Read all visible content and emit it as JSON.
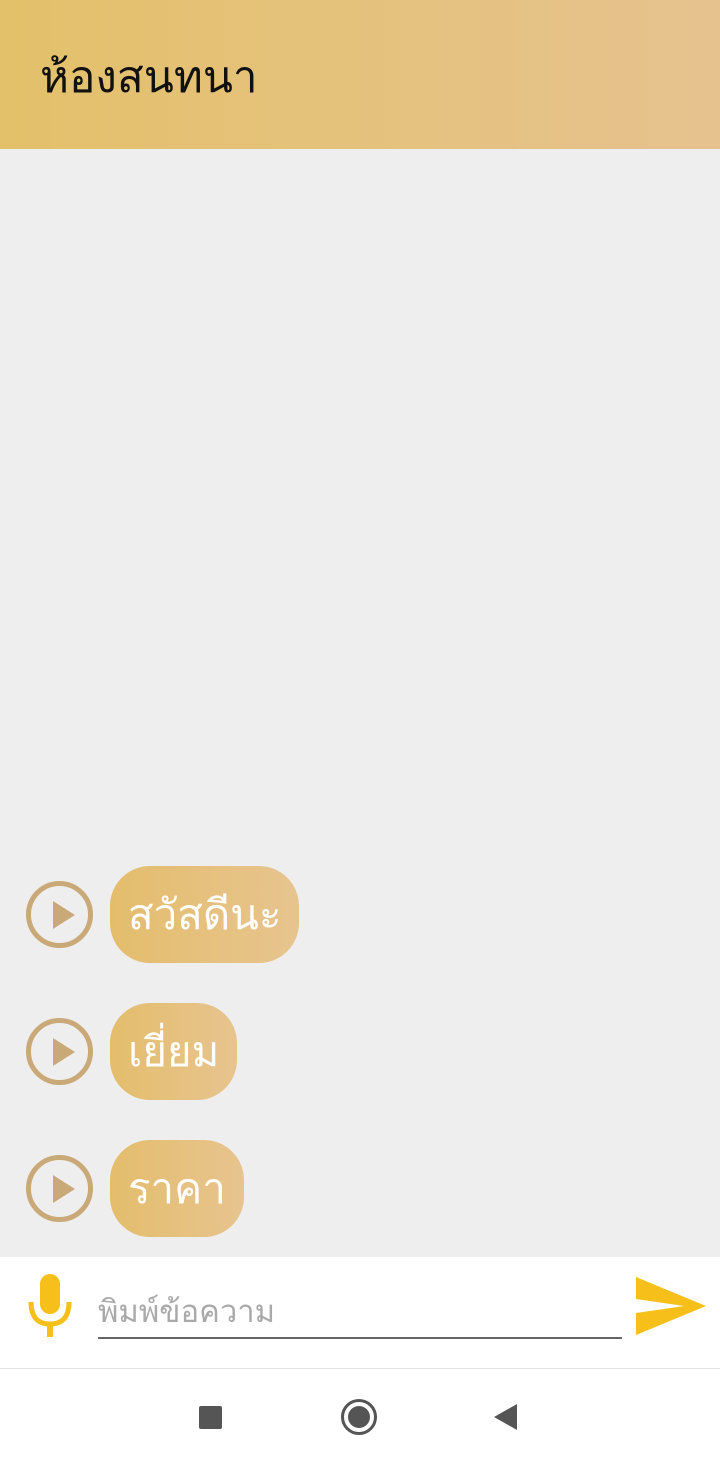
{
  "header": {
    "title": "ห้องสนทนา"
  },
  "messages": [
    {
      "text": "สวัสดีนะ",
      "play_icon": "play-circle-icon"
    },
    {
      "text": "เยี่ยม",
      "play_icon": "play-circle-icon"
    },
    {
      "text": "ราคา",
      "play_icon": "play-circle-icon"
    }
  ],
  "composer": {
    "placeholder": "พิมพ์ข้อความ",
    "value": "",
    "mic_icon": "microphone-icon",
    "send_icon": "send-icon"
  },
  "navbar": {
    "recents_icon": "square-icon",
    "home_icon": "circle-icon",
    "back_icon": "back-triangle-icon"
  },
  "colors": {
    "header_start": "#e3c16a",
    "header_end": "#e6c28f",
    "accent_yellow": "#f6bf1a",
    "play_brown": "#caa979",
    "background": "#eeeeee"
  }
}
